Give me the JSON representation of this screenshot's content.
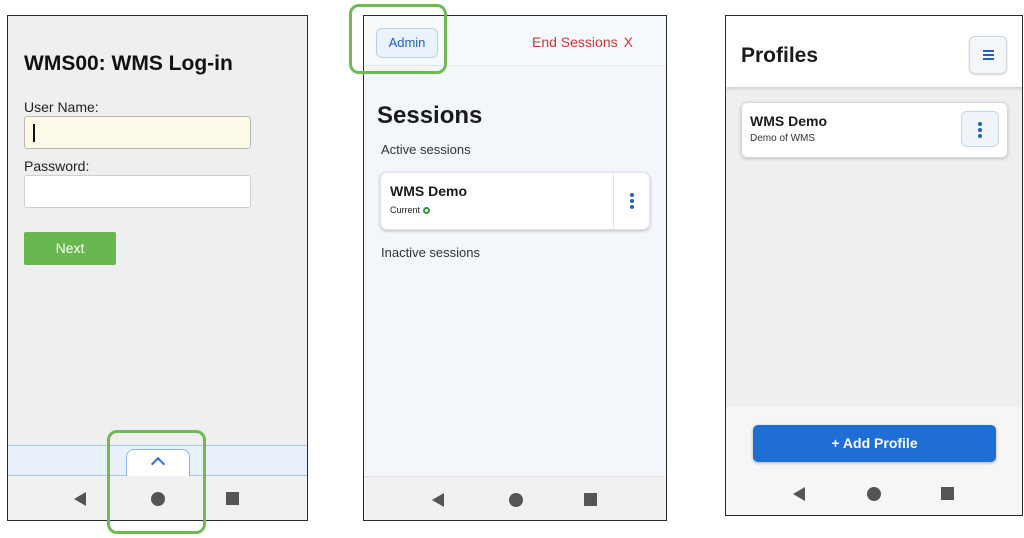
{
  "login_screen": {
    "title": "WMS00: WMS Log-in",
    "username_label": "User Name:",
    "username_value": "",
    "password_label": "Password:",
    "password_value": "",
    "next_label": "Next",
    "drawer_icon": "chevron-up-icon"
  },
  "sessions_screen": {
    "admin_label": "Admin",
    "end_sessions_label": "End Sessions",
    "end_sessions_icon": "X",
    "title": "Sessions",
    "active_label": "Active sessions",
    "sessions": [
      {
        "name": "WMS Demo",
        "status": "Current"
      }
    ],
    "inactive_label": "Inactive sessions"
  },
  "profiles_screen": {
    "title": "Profiles",
    "profiles": [
      {
        "name": "WMS Demo",
        "description": "Demo of WMS"
      }
    ],
    "add_profile_label": "+ Add Profile"
  },
  "colors": {
    "highlight": "#6fba52",
    "next_button": "#69b84f",
    "add_profile_button": "#1f6ed4",
    "end_sessions_text": "#d23232",
    "status_active": "#2b9a3c"
  }
}
